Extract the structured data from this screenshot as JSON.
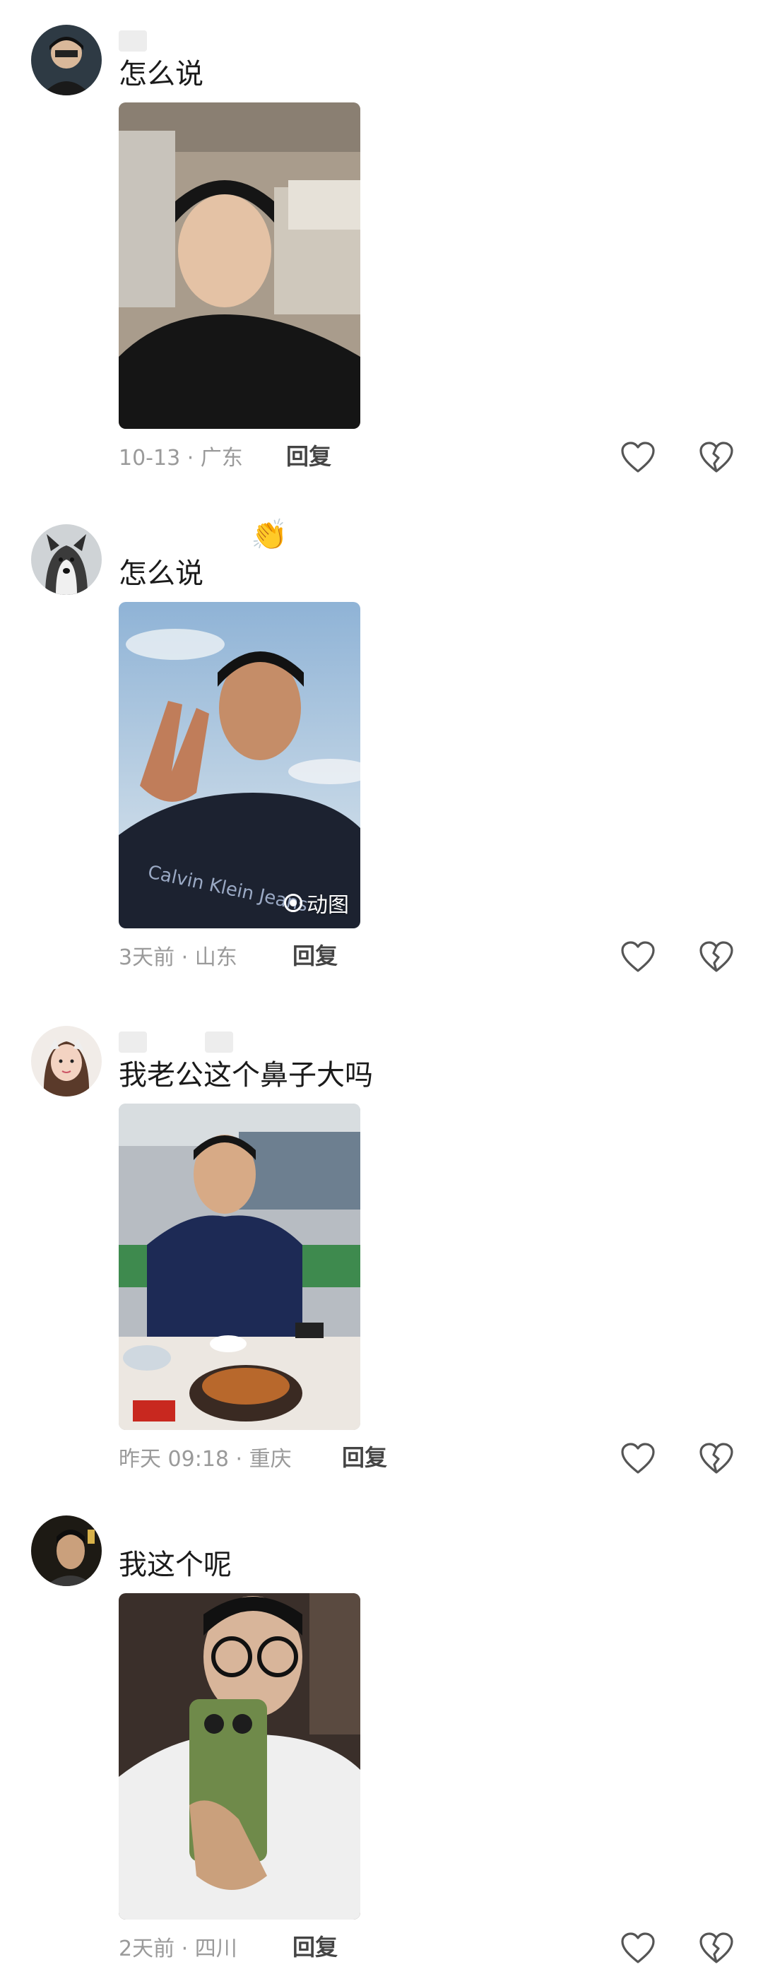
{
  "comments": [
    {
      "text": "怎么说",
      "time": "10-13 · 广东",
      "reply": "回复",
      "emoji": ""
    },
    {
      "text": "怎么说",
      "time": "3天前 · 山东",
      "reply": "回复",
      "emoji": "👏",
      "gif_label": "动图"
    },
    {
      "text": "我老公这个鼻子大吗",
      "time": "昨天 09:18 · 重庆",
      "reply": "回复",
      "emoji": ""
    },
    {
      "text": "我这个呢",
      "time": "2天前 · 四川",
      "reply": "回复",
      "emoji": ""
    }
  ],
  "colors": {
    "text": "#1b1b1b",
    "meta": "#9a9a9a",
    "icon": "#555555"
  }
}
